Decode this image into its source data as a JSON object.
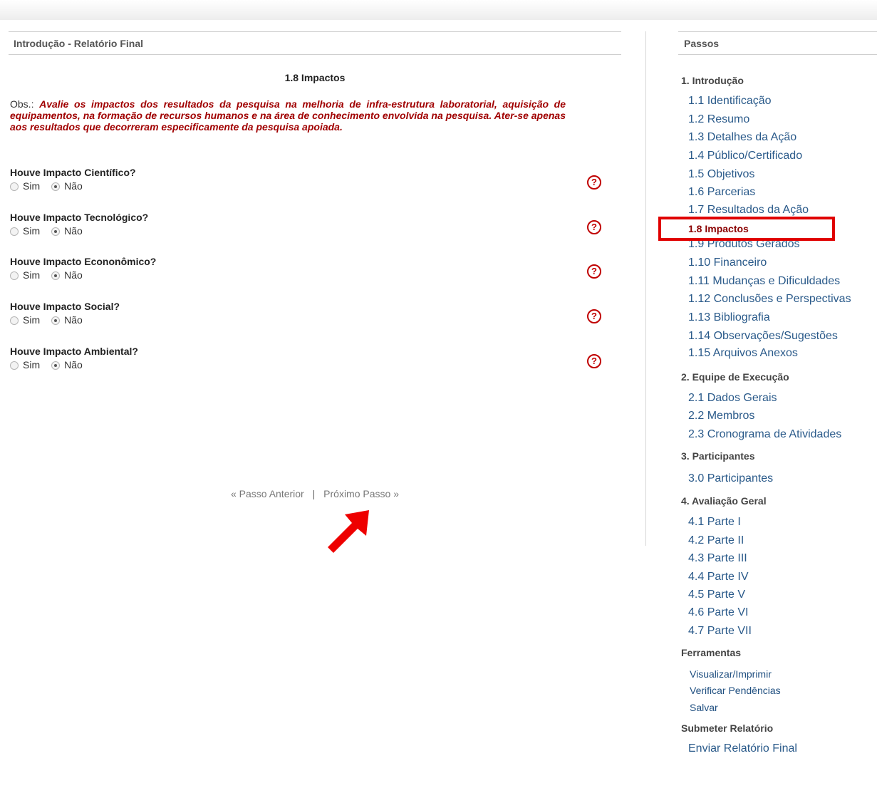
{
  "main": {
    "header": "Introdução - Relatório Final",
    "section_title": "1.8 Impactos",
    "obs_prefix": "Obs.:",
    "obs_text": "Avalie os impactos dos resultados da pesquisa na melhoria de infra-estrutura laboratorial, aquisição de equipamentos, na formação de recursos humanos e na área de conhecimento envolvida na pesquisa. Ater-se apenas aos resultados que decorreram especificamente da pesquisa apoiada.",
    "questions": [
      {
        "label": "Houve Impacto Científico?",
        "opt_yes": "Sim",
        "opt_no": "Não",
        "selected": "Não"
      },
      {
        "label": "Houve Impacto Tecnológico?",
        "opt_yes": "Sim",
        "opt_no": "Não",
        "selected": "Não"
      },
      {
        "label": "Houve Impacto Econonômico?",
        "opt_yes": "Sim",
        "opt_no": "Não",
        "selected": "Não"
      },
      {
        "label": "Houve Impacto Social?",
        "opt_yes": "Sim",
        "opt_no": "Não",
        "selected": "Não"
      },
      {
        "label": "Houve Impacto Ambiental?",
        "opt_yes": "Sim",
        "opt_no": "Não",
        "selected": "Não"
      }
    ],
    "help_glyph": "?",
    "prev_link": "« Passo Anterior",
    "separator": "|",
    "next_link": "Próximo Passo »"
  },
  "sidebar": {
    "header": "Passos",
    "groups": [
      {
        "label": "1. Introdução"
      },
      {
        "label": "2. Equipe de Execução"
      },
      {
        "label": "3. Participantes"
      },
      {
        "label": "4. Avaliação Geral"
      },
      {
        "label": "Ferramentas"
      },
      {
        "label": "Submeter Relatório"
      }
    ],
    "intro_items": [
      "1.1 Identificação",
      "1.2 Resumo",
      "1.3 Detalhes da Ação",
      "1.4 Público/Certificado",
      "1.5 Objetivos",
      "1.6 Parcerias",
      "1.7 Resultados da Ação",
      "1.8 Impactos",
      "1.9 Produtos Gerados",
      "1.10 Financeiro",
      "1.11 Mudanças e Dificuldades",
      "1.12 Conclusões e Perspectivas",
      "1.13 Bibliografia",
      "1.14 Observações/Sugestões",
      "1.15 Arquivos Anexos"
    ],
    "team_items": [
      "2.1 Dados Gerais",
      "2.2 Membros",
      "2.3 Cronograma de Atividades"
    ],
    "participant_items": [
      "3.0 Participantes"
    ],
    "evaluation_items": [
      "4.1 Parte I",
      "4.2 Parte II",
      "4.3 Parte III",
      "4.4 Parte IV",
      "4.5 Parte V",
      "4.6 Parte VI",
      "4.7 Parte VII"
    ],
    "tool_items": [
      "Visualizar/Imprimir",
      "Verificar Pendências",
      "Salvar"
    ],
    "submit_items": [
      "Enviar Relatório Final"
    ],
    "current_item": "1.8 Impactos"
  },
  "colors": {
    "highlight": "#e00000",
    "link": "#2a5a8a",
    "obs_text": "#a00000",
    "help_icon": "#c00000"
  },
  "icons": [
    "help-circle-icon",
    "red-arrow-annotation-icon",
    "radio-button-icon"
  ]
}
